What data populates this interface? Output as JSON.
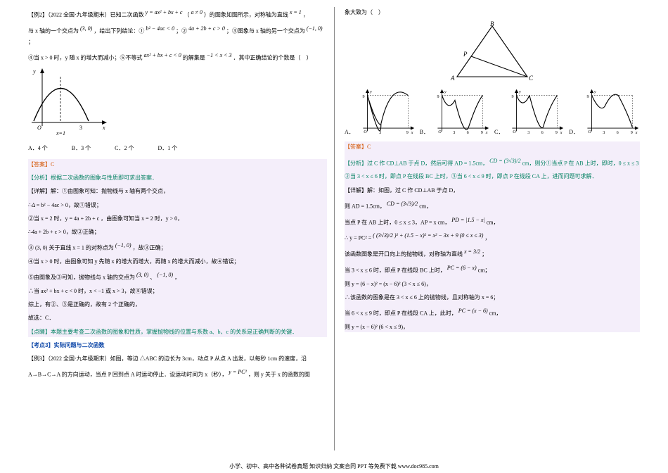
{
  "left": {
    "line1a": "【例2】（2022 全国·九年级期末）已知二次函数 ",
    "line1math": "y = ax² + bx + c",
    "line1b": "（",
    "line1c": " a ≠ 0 ",
    "line1d": "）的图象如图所示，对称轴为直线",
    "line1e": " x = 1 ",
    "line1f": "，",
    "line2a": "与 x 轴的一个交点为 ",
    "line2b": "(3, 0) ",
    "line2c": "，给出下列结论：①",
    "line2d": " b² − 4ac < 0 ",
    "line2e": "；②",
    "line2f": " 4a + 2b + c > 0 ",
    "line2g": "；③图象与 x 轴的另一个交点为",
    "line2h": " (−1, 0) ",
    "line2i": "；",
    "line3a": "④当 x > 0 时，y 随 x 的增大而减小；⑤不等式 ",
    "line3b": "ax² + bx + c < 0",
    "line3c": " 的解集是 ",
    "line3d": "−1 < x < 3",
    "line3e": " ．其中正确结论的个数是（　）",
    "options": {
      "a": "A．4 个",
      "b": "B．3 个",
      "c": "C．2 个",
      "d": "D．1 个"
    },
    "ans": "【答案】C",
    "ana": "【分析】根据二次函数的图象与性质即可求出答案．",
    "d1": "【详解】解：①由图象可知：抛物线与 x 轴有两个交点，",
    "d2": "∴Δ = b² − 4ac > 0，故①错误；",
    "d3": "②当 x = 2 时，y = 4a + 2b + c ，由图象可知当 x = 2 时，y > 0，",
    "d4": "∴4a + 2b + c > 0，故②正确；",
    "d5a": "③ (3, 0) 关于直线 x = 1 的对称点为 ",
    "d5b": "(−1, 0) ",
    "d5c": "，故③正确；",
    "d6": "④当 x > 0 时，由图象可知 y 先随 x 的增大而增大，再随 x 的增大而减小，故④错误；",
    "d7a": "⑤由图象及③可知，抛物线与 x 轴的交点为 ",
    "d7b": "(3, 0) ",
    "d7c": "、",
    "d7d": "(−1, 0) ",
    "d7e": "，",
    "d8": "∴当 ax² + bx + c < 0 时，x < −1 或 x > 3，故⑤错误；",
    "d9": "综上，有②、③是正确的，故有 2 个正确的，",
    "d10": "故选：C．",
    "tip": "【点睛】本题主要考查二次函数的图象和性质，掌握抛物线的位置与系数 a、b、c 的关系是正确判断的关键．",
    "kp": "【考点3】实际问题与二次函数",
    "ex3a": "【例3】（2022 全国·九年级期末）如图，等边 △ABC 的边长为 3cm，动点 P 从点 A 出发，以每秒 1cm 的速度，沿",
    "ex3b": "A→B→C→A 的方向运动，当点 P 回到点 A 时运动停止．设运动时间为 x（秒），",
    "ex3c": " y = PC² ",
    "ex3d": "，则 y 关于 x 的函数的图"
  },
  "right": {
    "top": "象大致为（　）",
    "tri": {
      "A": "A",
      "B": "B",
      "C": "C",
      "P": "P"
    },
    "optLab": {
      "A": "A．",
      "B": "B．",
      "C": "C．",
      "D": "D．"
    },
    "axis": {
      "y9": "9",
      "x3": "3",
      "x6": "6",
      "x9": "9",
      "xl": "x",
      "yl": "y",
      "o": "O"
    },
    "ans": "【答案】C",
    "ana1": "【分析】过 C 作 CD⊥AB 于点 D，然后可得 AD = 1.5cm，",
    "ana1f": " CD = (3√3)/2 ",
    "ana1b": "cm，则分①当点 P 在 AB 上时，即时，0 ≤ x ≤ 3",
    "ana2": "②当 3 < x ≤ 6 时，即点 P 在线段 BC 上时，③当 6 < x ≤ 9 时，即点 P 在线段 CA 上，进而问题可求解．",
    "d0": "【详解】解：如图，过 C 作 CD⊥AB 于点 D，",
    "d1": "则 AD = 1.5cm，",
    "d1f": " CD = (3√3)/2 ",
    "d1b": "cm，",
    "d2a": "当点 P 在 AB 上时，0 ≤ x ≤ 3，AP = x cm，",
    "d2b": " PD = |1.5 − x| ",
    "d2c": "cm，",
    "d3a": "∴ y = PC² = ",
    "d3b": "( (3√3)/2 )² + (1.5 − x)² = x² − 3x + 9 (0 ≤ x ≤ 3)",
    "d3c": "，",
    "d4a": "该函数图象是开口向上的抛物线，对称轴为直线",
    "d4b": " x = 3/2 ",
    "d4c": "；",
    "d5a": "当 3 < x ≤ 6 时，即点 P 在线段 BC 上时，",
    "d5b": " PC = (6 − x) ",
    "d5c": "cm；",
    "d6a": "则 y = (6 − x)² = (x − 6)² (3 < x ≤ 6)，",
    "d7a": "∴该函数的图象是在 3 < x ≤ 6 上的抛物线，且对称轴为 x = 6；",
    "d8a": "当 6 < x ≤ 9 时，即点 P 在线段 CA 上，此时，",
    "d8b": " PC = (x − 6) ",
    "d8c": "cm，",
    "d9a": "则 y = (x − 6)² (6 < x ≤ 9)，"
  },
  "footer": "小学、初中、高中各种试卷真题 知识归纳 文案合同  PPT 等免费下载   www.doc985.com",
  "chart_data": [
    {
      "type": "line",
      "title": "Example 2 parabola",
      "xlabel": "x",
      "ylabel": "y",
      "x": [
        -1,
        0,
        1,
        2,
        3
      ],
      "values": [
        0,
        3,
        4,
        3,
        0
      ],
      "axis_of_symmetry": 1,
      "x_intercepts": [
        -1,
        3
      ]
    },
    {
      "type": "line",
      "title": "Option A piecewise (single quadratic fall then rise)",
      "xlabel": "x",
      "ylabel": "y",
      "xlim": [
        0,
        9
      ],
      "ylim": [
        0,
        9
      ],
      "series": [
        {
          "name": "y",
          "x": [
            0,
            3,
            9
          ],
          "values": [
            9,
            1,
            9
          ]
        }
      ]
    },
    {
      "type": "line",
      "title": "Option B piecewise",
      "xlabel": "x",
      "ylabel": "y",
      "xlim": [
        0,
        9
      ],
      "ylim": [
        0,
        9
      ],
      "series": [
        {
          "name": "y",
          "x": [
            0,
            1.5,
            3,
            6,
            9
          ],
          "values": [
            9,
            6.75,
            9,
            0,
            9
          ]
        }
      ]
    },
    {
      "type": "line",
      "title": "Option C piecewise (correct)",
      "xlabel": "x",
      "ylabel": "y",
      "xlim": [
        0,
        9
      ],
      "ylim": [
        0,
        9
      ],
      "series": [
        {
          "name": "y",
          "x": [
            0,
            1.5,
            3,
            6,
            9
          ],
          "values": [
            9,
            6.75,
            9,
            0,
            9
          ]
        }
      ]
    },
    {
      "type": "line",
      "title": "Option D piecewise",
      "xlabel": "x",
      "ylabel": "y",
      "xlim": [
        0,
        9
      ],
      "ylim": [
        0,
        9
      ],
      "series": [
        {
          "name": "y",
          "x": [
            0,
            3,
            6,
            9
          ],
          "values": [
            9,
            6.75,
            9,
            0
          ]
        }
      ]
    }
  ]
}
